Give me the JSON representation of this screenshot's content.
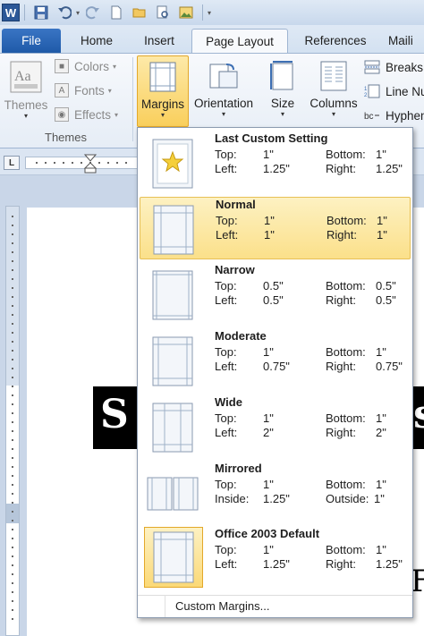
{
  "app": {
    "logo_letter": "W"
  },
  "tabs": [
    {
      "label": "File"
    },
    {
      "label": "Home"
    },
    {
      "label": "Insert"
    },
    {
      "label": "Page Layout"
    },
    {
      "label": "References"
    },
    {
      "label": "Maili"
    }
  ],
  "ribbon": {
    "themes": {
      "label": "Themes",
      "group_label": "Themes",
      "colors": "Colors",
      "fonts": "Fonts",
      "effects": "Effects"
    },
    "margins": {
      "label": "Margins"
    },
    "orientation": {
      "label": "Orientation"
    },
    "size": {
      "label": "Size"
    },
    "columns": {
      "label": "Columns"
    },
    "breaks": {
      "label": "Breaks"
    },
    "line_numbers": {
      "label": "Line Nu"
    },
    "hyphenation": {
      "label": "Hyphen"
    }
  },
  "document": {
    "text_left": "S",
    "text_right": "s",
    "text_bottom": "F"
  },
  "margins_menu": {
    "items": [
      {
        "title": "Last Custom Setting",
        "row1": [
          "Top:",
          "1\"",
          "Bottom:",
          "1\""
        ],
        "row2": [
          "Left:",
          "1.25\"",
          "Right:",
          "1.25\""
        ],
        "icon": "star-icon",
        "hover": false
      },
      {
        "title": "Normal",
        "row1": [
          "Top:",
          "1\"",
          "Bottom:",
          "1\""
        ],
        "row2": [
          "Left:",
          "1\"",
          "Right:",
          "1\""
        ],
        "icon": "page-normal-icon",
        "hover": true
      },
      {
        "title": "Narrow",
        "row1": [
          "Top:",
          "0.5\"",
          "Bottom:",
          "0.5\""
        ],
        "row2": [
          "Left:",
          "0.5\"",
          "Right:",
          "0.5\""
        ],
        "icon": "page-narrow-icon",
        "hover": false
      },
      {
        "title": "Moderate",
        "row1": [
          "Top:",
          "1\"",
          "Bottom:",
          "1\""
        ],
        "row2": [
          "Left:",
          "0.75\"",
          "Right:",
          "0.75\""
        ],
        "icon": "page-moderate-icon",
        "hover": false
      },
      {
        "title": "Wide",
        "row1": [
          "Top:",
          "1\"",
          "Bottom:",
          "1\""
        ],
        "row2": [
          "Left:",
          "2\"",
          "Right:",
          "2\""
        ],
        "icon": "page-wide-icon",
        "hover": false
      },
      {
        "title": "Mirrored",
        "row1": [
          "Top:",
          "1\"",
          "Bottom:",
          "1\""
        ],
        "row2": [
          "Inside:",
          "1.25\"",
          "Outside:",
          "1\""
        ],
        "icon": "page-mirrored-icon",
        "hover": false
      },
      {
        "title": "Office 2003 Default",
        "row1": [
          "Top:",
          "1\"",
          "Bottom:",
          "1\""
        ],
        "row2": [
          "Left:",
          "1.25\"",
          "Right:",
          "1.25\""
        ],
        "icon": "page-office2003-icon",
        "hover": false,
        "selected": true
      }
    ],
    "footer": "Custom Margins..."
  }
}
